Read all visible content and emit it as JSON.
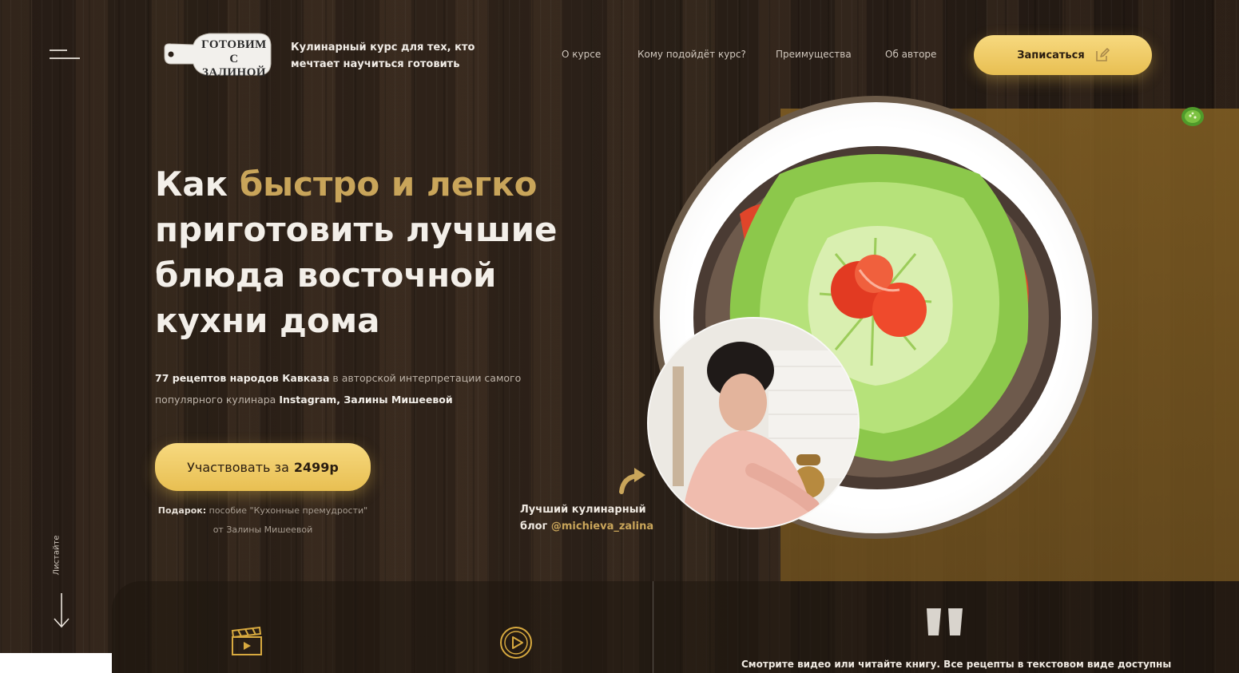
{
  "header": {
    "logo_line1": "ГОТОВИМ",
    "logo_line2": "С ЗАЛИНОЙ",
    "tagline": "Кулинарный курс для тех, кто мечтает научиться готовить",
    "nav": [
      "О курсе",
      "Кому подойдёт курс?",
      "Преимущества",
      "Об авторе"
    ],
    "signup_label": "Записаться"
  },
  "hero": {
    "headline_part1": "Как ",
    "headline_highlight": "быстро и легко",
    "headline_part2": " приготовить лучшие блюда восточной кухни дома",
    "sub_b1": "77 рецептов народов Кавказа",
    "sub_t1": " в авторской интерпретации самого популярного кулинара ",
    "sub_b2": "Instagram, Залины Мишеевой",
    "cta_prefix": "Участвовать за",
    "cta_price": "2499р",
    "gift_b": "Подарок:",
    "gift_text": " пособие \"Кухонные премудрости\" от Залины Мишеевой",
    "scroll_label": "Листайте"
  },
  "author": {
    "blog_line1": "Лучший кулинарный",
    "blog_prefix": "блог ",
    "blog_handle": "@michieva_zalina"
  },
  "bottom": {
    "text": "Смотрите видео или читайте книгу. Все рецепты в текстовом виде доступны"
  },
  "icons": {
    "menu": "menu-icon",
    "edit": "edit-icon",
    "arrow_down": "arrow-down-icon",
    "clapperboard": "clapperboard-icon",
    "play": "play-icon",
    "quote": "quote-icon",
    "pepper": "pepper-icon",
    "curved_arrow": "curved-arrow-icon"
  },
  "colors": {
    "accent_gold": "#c9a55a",
    "button_gold": "#f0cd66",
    "background": "#2b2018"
  }
}
